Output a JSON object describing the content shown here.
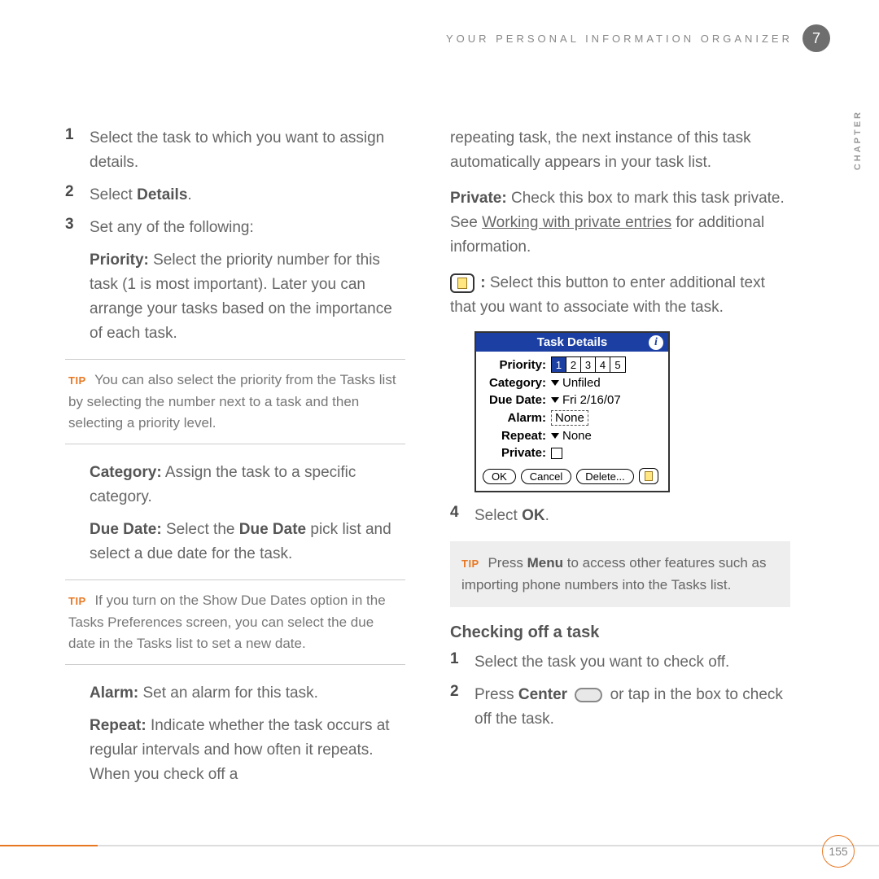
{
  "header": {
    "title": "YOUR PERSONAL INFORMATION ORGANIZER",
    "chapter_num": "7",
    "chapter_word": "CHAPTER"
  },
  "left": {
    "step1": {
      "num": "1",
      "text": "Select the task to which you want to assign details."
    },
    "step2": {
      "num": "2",
      "prefix": "Select ",
      "bold": "Details",
      "suffix": "."
    },
    "step3": {
      "num": "3",
      "text": "Set any of the following:"
    },
    "priority": {
      "label": "Priority:",
      "text": " Select the priority number for this task (1 is most important). Later you can arrange your tasks based on the importance of each task."
    },
    "tip1": {
      "label": "TIP",
      "text": " You can also select the priority from the Tasks list by selecting the number next to a task and then selecting a priority level."
    },
    "category": {
      "label": "Category:",
      "text": " Assign the task to a specific category."
    },
    "duedate": {
      "label": "Due Date:",
      "pre": " Select the ",
      "bold": "Due Date",
      "post": " pick list and select a due date for the task."
    },
    "tip2": {
      "label": "TIP",
      "text": " If you turn on the Show Due Dates option in the Tasks Preferences screen, you can select the due date in the Tasks list to set a new date."
    },
    "alarm": {
      "label": "Alarm:",
      "text": " Set an alarm for this task."
    },
    "repeat": {
      "label": "Repeat:",
      "text": " Indicate whether the task occurs at regular intervals and how often it repeats. When you check off a"
    }
  },
  "right": {
    "cont": "repeating task, the next instance of this task automatically appears in your task list.",
    "private": {
      "label": "Private:",
      "pre": " Check this box to mark this task private. See ",
      "link": "Working with private entries",
      "post": " for additional information."
    },
    "note": {
      "colon": " :",
      "text": " Select this button to enter additional text that you want to associate with the task."
    },
    "step4": {
      "num": "4",
      "prefix": "Select ",
      "bold": "OK",
      "suffix": "."
    },
    "tip3": {
      "label": "TIP",
      "pre": " Press ",
      "bold": "Menu",
      "post": " to access other features such as importing phone numbers into the Tasks list."
    },
    "section": "Checking off a task",
    "co_step1": {
      "num": "1",
      "text": "Select the task you want to check off."
    },
    "co_step2": {
      "num": "2",
      "pre": "Press ",
      "bold": "Center",
      "post": " or tap in the box to check off the task."
    }
  },
  "dialog": {
    "title": "Task Details",
    "rows": {
      "priority": {
        "label": "Priority:",
        "cells": [
          "1",
          "2",
          "3",
          "4",
          "5"
        ],
        "selected": "1"
      },
      "category": {
        "label": "Category:",
        "value": "Unfiled"
      },
      "duedate": {
        "label": "Due Date:",
        "value": "Fri 2/16/07"
      },
      "alarm": {
        "label": "Alarm:",
        "value": "None"
      },
      "repeat": {
        "label": "Repeat:",
        "value": "None"
      },
      "private": {
        "label": "Private:"
      }
    },
    "buttons": {
      "ok": "OK",
      "cancel": "Cancel",
      "delete": "Delete..."
    }
  },
  "page_number": "155"
}
